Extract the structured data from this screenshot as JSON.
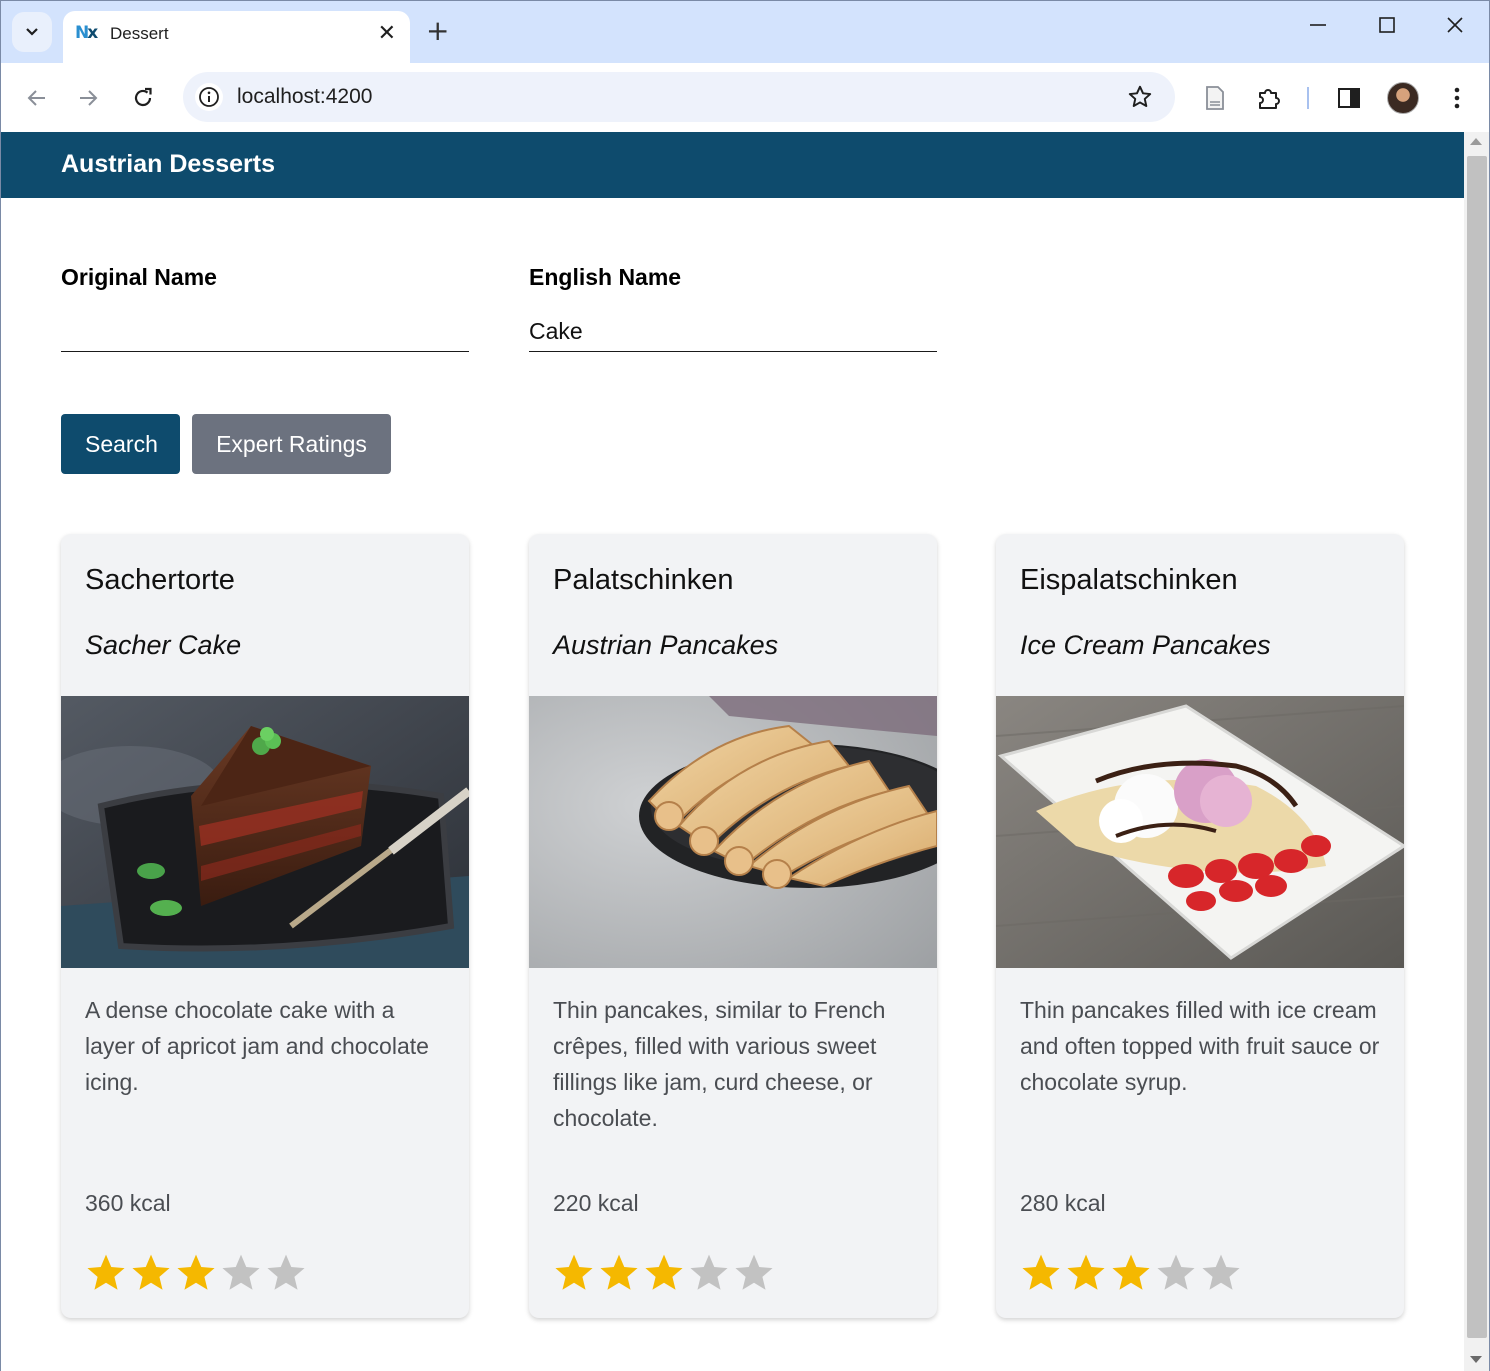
{
  "browser": {
    "tab_title": "Dessert",
    "tab_favicon_text": "Nx",
    "url": "localhost:4200",
    "icons": [
      "chevron-down-icon",
      "close-icon",
      "plus-icon",
      "minimize-icon",
      "maximize-icon",
      "window-close-icon",
      "back-arrow-icon",
      "forward-arrow-icon",
      "reload-icon",
      "info-icon",
      "star-icon",
      "page-icon",
      "extensions-icon",
      "side-panel-icon",
      "avatar",
      "more-vert-icon"
    ]
  },
  "app": {
    "title": "Austrian Desserts",
    "header_color": "#0e4b6d"
  },
  "filters": {
    "original_name": {
      "label": "Original Name",
      "value": ""
    },
    "english_name": {
      "label": "English Name",
      "value": "Cake"
    }
  },
  "actions": {
    "search_label": "Search",
    "expert_ratings_label": "Expert Ratings"
  },
  "desserts": [
    {
      "original_name": "Sachertorte",
      "english_name": "Sacher Cake",
      "image": "chocolate-cake-slice-photo",
      "description": "A dense chocolate cake with a layer of apricot jam and chocolate icing.",
      "kcal": "360 kcal",
      "rating": 3,
      "max_rating": 5
    },
    {
      "original_name": "Palatschinken",
      "english_name": "Austrian Pancakes",
      "image": "rolled-pancakes-photo",
      "description": "Thin pancakes, similar to French crêpes, filled with various sweet fillings like jam, curd cheese, or chocolate.",
      "kcal": "220 kcal",
      "rating": 3,
      "max_rating": 5
    },
    {
      "original_name": "Eispalatschinken",
      "english_name": "Ice Cream Pancakes",
      "image": "ice-cream-pancakes-photo",
      "description": "Thin pancakes filled with ice cream and often topped with fruit sauce or chocolate syrup.",
      "kcal": "280 kcal",
      "rating": 3,
      "max_rating": 5
    }
  ],
  "colors": {
    "star_filled": "#f5b800",
    "star_empty": "#c2c2c2",
    "card_bg": "#f2f3f5",
    "secondary_button": "#6c727f"
  }
}
